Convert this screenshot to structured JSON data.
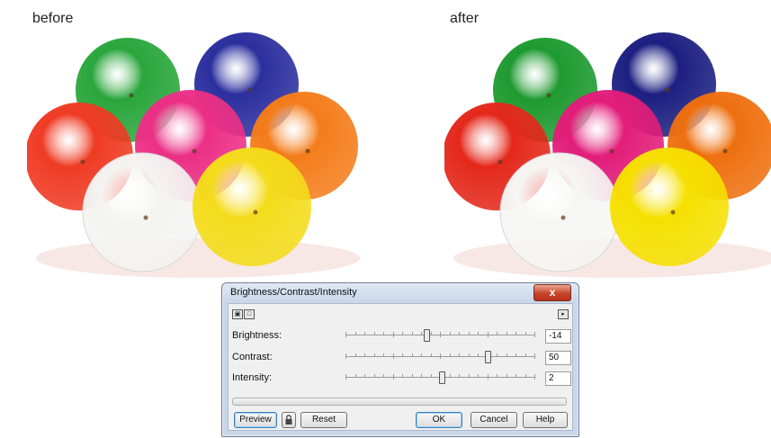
{
  "captions": {
    "before": "before",
    "after": "after"
  },
  "dialog": {
    "title": "Brightness/Contrast/Intensity",
    "close_glyph": "x",
    "sliders": [
      {
        "label": "Brightness:",
        "value": "-14",
        "level": 0.43
      },
      {
        "label": "Contrast:",
        "value": "50",
        "level": 0.75
      },
      {
        "label": "Intensity:",
        "value": "2",
        "level": 0.51
      }
    ],
    "buttons": {
      "preview": "Preview",
      "reset": "Reset",
      "ok": "OK",
      "cancel": "Cancel",
      "help": "Help"
    },
    "icons": {
      "view_a": "split-view-icon",
      "view_b": "single-view-icon",
      "expand": "expand-arrow-icon",
      "lock": "lock-icon"
    }
  },
  "colors": {
    "balls_before": [
      "#2aa63c",
      "#2b2f9e",
      "#ef3b24",
      "#ec2f86",
      "#f47c1a",
      "#f4f4f2",
      "#f4dc1a"
    ],
    "balls_after": [
      "#1e9a30",
      "#1c1f80",
      "#e4281b",
      "#e21d7a",
      "#ee6f0e",
      "#f6f6f4",
      "#f6e000"
    ]
  }
}
